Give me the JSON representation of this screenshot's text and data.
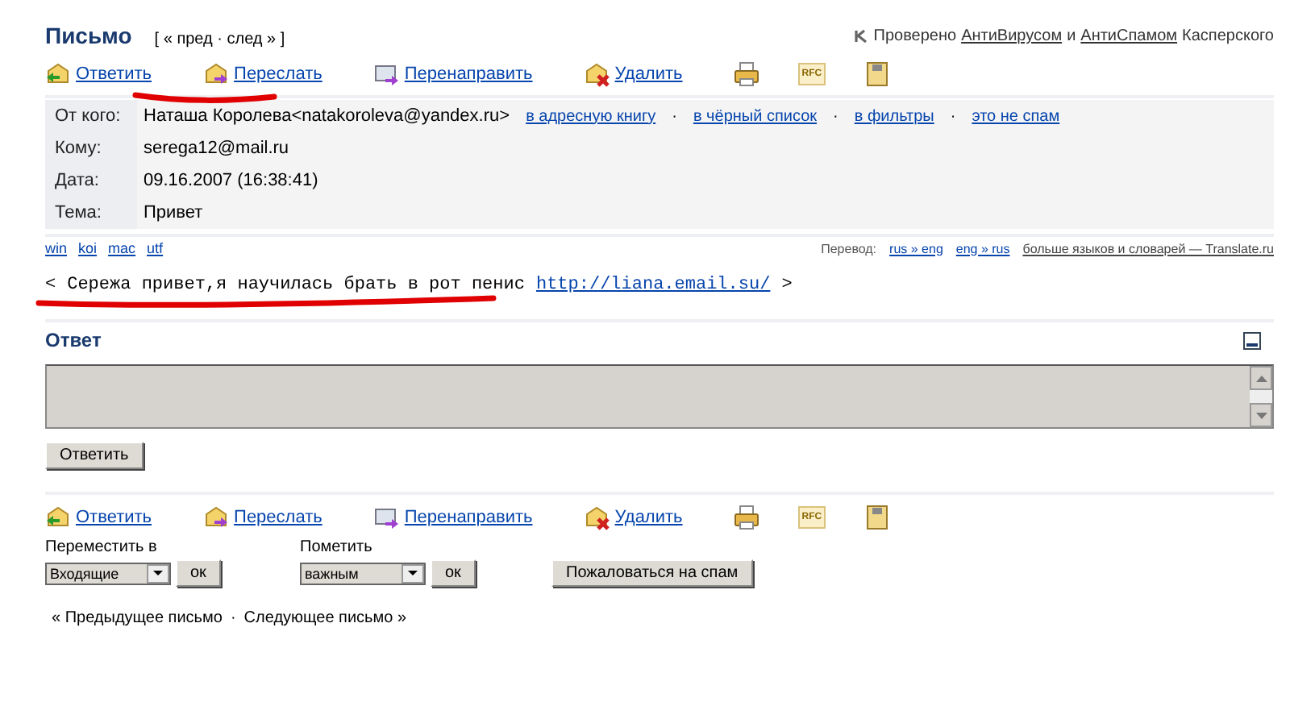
{
  "header": {
    "title": "Письмо",
    "nav": "[ « пред · след » ]",
    "check": {
      "prefix": "Проверено",
      "link1": "АнтиВирусом",
      "middle": "и",
      "link2": "АнтиСпамом",
      "suffix": "Касперского"
    }
  },
  "toolbar_top": [
    {
      "kind": "reply",
      "label": "Ответить"
    },
    {
      "kind": "forward",
      "label": "Переслать"
    },
    {
      "kind": "redirect",
      "label": "Перенаправить"
    },
    {
      "kind": "delete",
      "label": "Удалить"
    },
    {
      "kind": "print"
    },
    {
      "kind": "rfc",
      "label": "RFC"
    },
    {
      "kind": "save"
    }
  ],
  "fields": [
    {
      "label": "От кого:",
      "value": "Наташа Королева<natakoroleva@yandex.ru>",
      "links": [
        "в адресную книгу",
        "в чёрный список",
        "в фильтры",
        "это не спам"
      ],
      "separator": "·"
    },
    {
      "label": "Кому:",
      "value": "serega12@mail.ru"
    },
    {
      "label": "Дата:",
      "value": "09.16.2007 (16:38:41)"
    },
    {
      "label": "Тема:",
      "value": "Привет"
    }
  ],
  "encodings": [
    "win",
    "koi",
    "mac",
    "utf"
  ],
  "translate": {
    "label": "Перевод:",
    "links": [
      "rus » eng",
      "eng » rus",
      "больше языков и словарей — Translate.ru"
    ]
  },
  "body": {
    "open": "<",
    "text": "Сережа привет,я научилась брать в рот пенис",
    "link": "http://liana.email.su/",
    "close": ">"
  },
  "reply": {
    "title": "Ответ",
    "button": "Ответить"
  },
  "toolbar_bottom": [
    {
      "kind": "reply",
      "label": "Ответить"
    },
    {
      "kind": "forward",
      "label": "Переслать"
    },
    {
      "kind": "redirect",
      "label": "Перенаправить"
    },
    {
      "kind": "delete",
      "label": "Удалить"
    },
    {
      "kind": "print"
    },
    {
      "kind": "rfc",
      "label": "RFC"
    },
    {
      "kind": "save"
    }
  ],
  "move": {
    "label": "Переместить в",
    "value": "Входящие",
    "button": "ок"
  },
  "mark": {
    "label": "Пометить",
    "value": "важным",
    "button": "ок"
  },
  "spam_button": "Пожаловаться на спам",
  "pager": {
    "prev": "« Предыдущее письмо",
    "sep": "·",
    "next": "Следующее письмо »"
  }
}
